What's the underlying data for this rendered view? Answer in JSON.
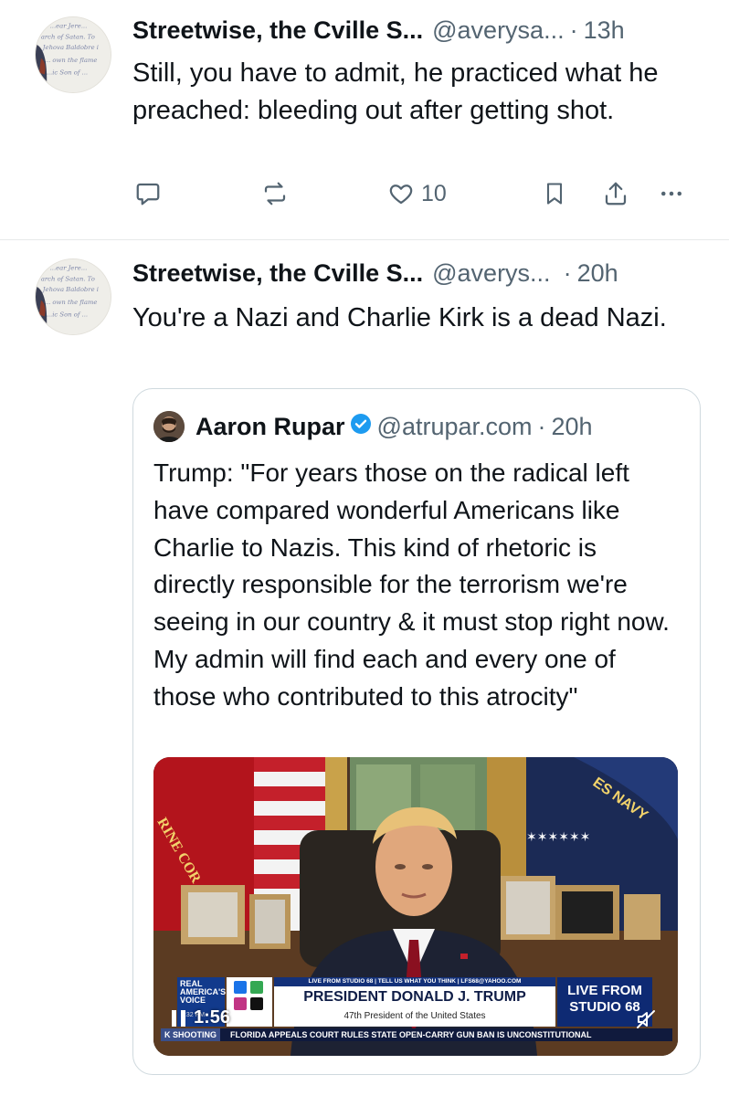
{
  "posts": [
    {
      "author": {
        "name": "Streetwise, the Cville S...",
        "handle": "@averysa...",
        "time": "13h",
        "avatar_text": [
          "...ear Jere...",
          "arch of Satan. To",
          "Jehova Baldobre i",
          "... own the flame",
          "...ic Son of ..."
        ]
      },
      "text": "Still, you have to admit, he practiced what he preached: bleeding out after getting shot.",
      "actions": {
        "reply_icon": "reply-icon",
        "repost_icon": "repost-icon",
        "like_icon": "heart-icon",
        "like_count": "10",
        "bookmark_icon": "bookmark-icon",
        "share_icon": "share-icon",
        "more_icon": "more-icon"
      }
    },
    {
      "author": {
        "name": "Streetwise, the Cville S...",
        "handle": "@averys...",
        "time": "20h"
      },
      "text": "You're a Nazi and Charlie Kirk is a dead Nazi.",
      "quote": {
        "name": "Aaron Rupar",
        "verified_icon": "verified-badge-icon",
        "handle": "@atrupar.com",
        "time": "20h",
        "text": "Trump: \"For years those on the radical left have compared wonderful Americans like Charlie to Nazis. This kind of rhetoric is directly responsible for the terrorism we're seeing in our country & it must stop right now. My admin will find each and every one of those who contributed to this atrocity\"",
        "video": {
          "elapsed": "1:56",
          "overlay_clock": "7:32 PM",
          "flag_text_left": "RINE COR",
          "flag_text_right": "ES NAVY",
          "chyron": {
            "network_logo": "REAL AMERICA'S VOICE",
            "top_bar": "LIVE FROM STUDIO 68 | TELL US WHAT YOU THINK | LFS68@YAHOO.COM",
            "title": "PRESIDENT DONALD J. TRUMP",
            "subtitle": "47th President of the United States",
            "studio": "LIVE FROM STUDIO 68",
            "ticker_label": "K SHOOTING",
            "ticker": "FLORIDA APPEALS COURT RULES STATE OPEN-CARRY GUN BAN IS UNCONSTITUTIONAL"
          }
        }
      }
    }
  ],
  "colors": {
    "text_primary": "#0f1419",
    "text_secondary": "#536471",
    "divider": "#e7e9ea",
    "quote_border": "#cfd9de",
    "verified": "#1d9bf0"
  }
}
